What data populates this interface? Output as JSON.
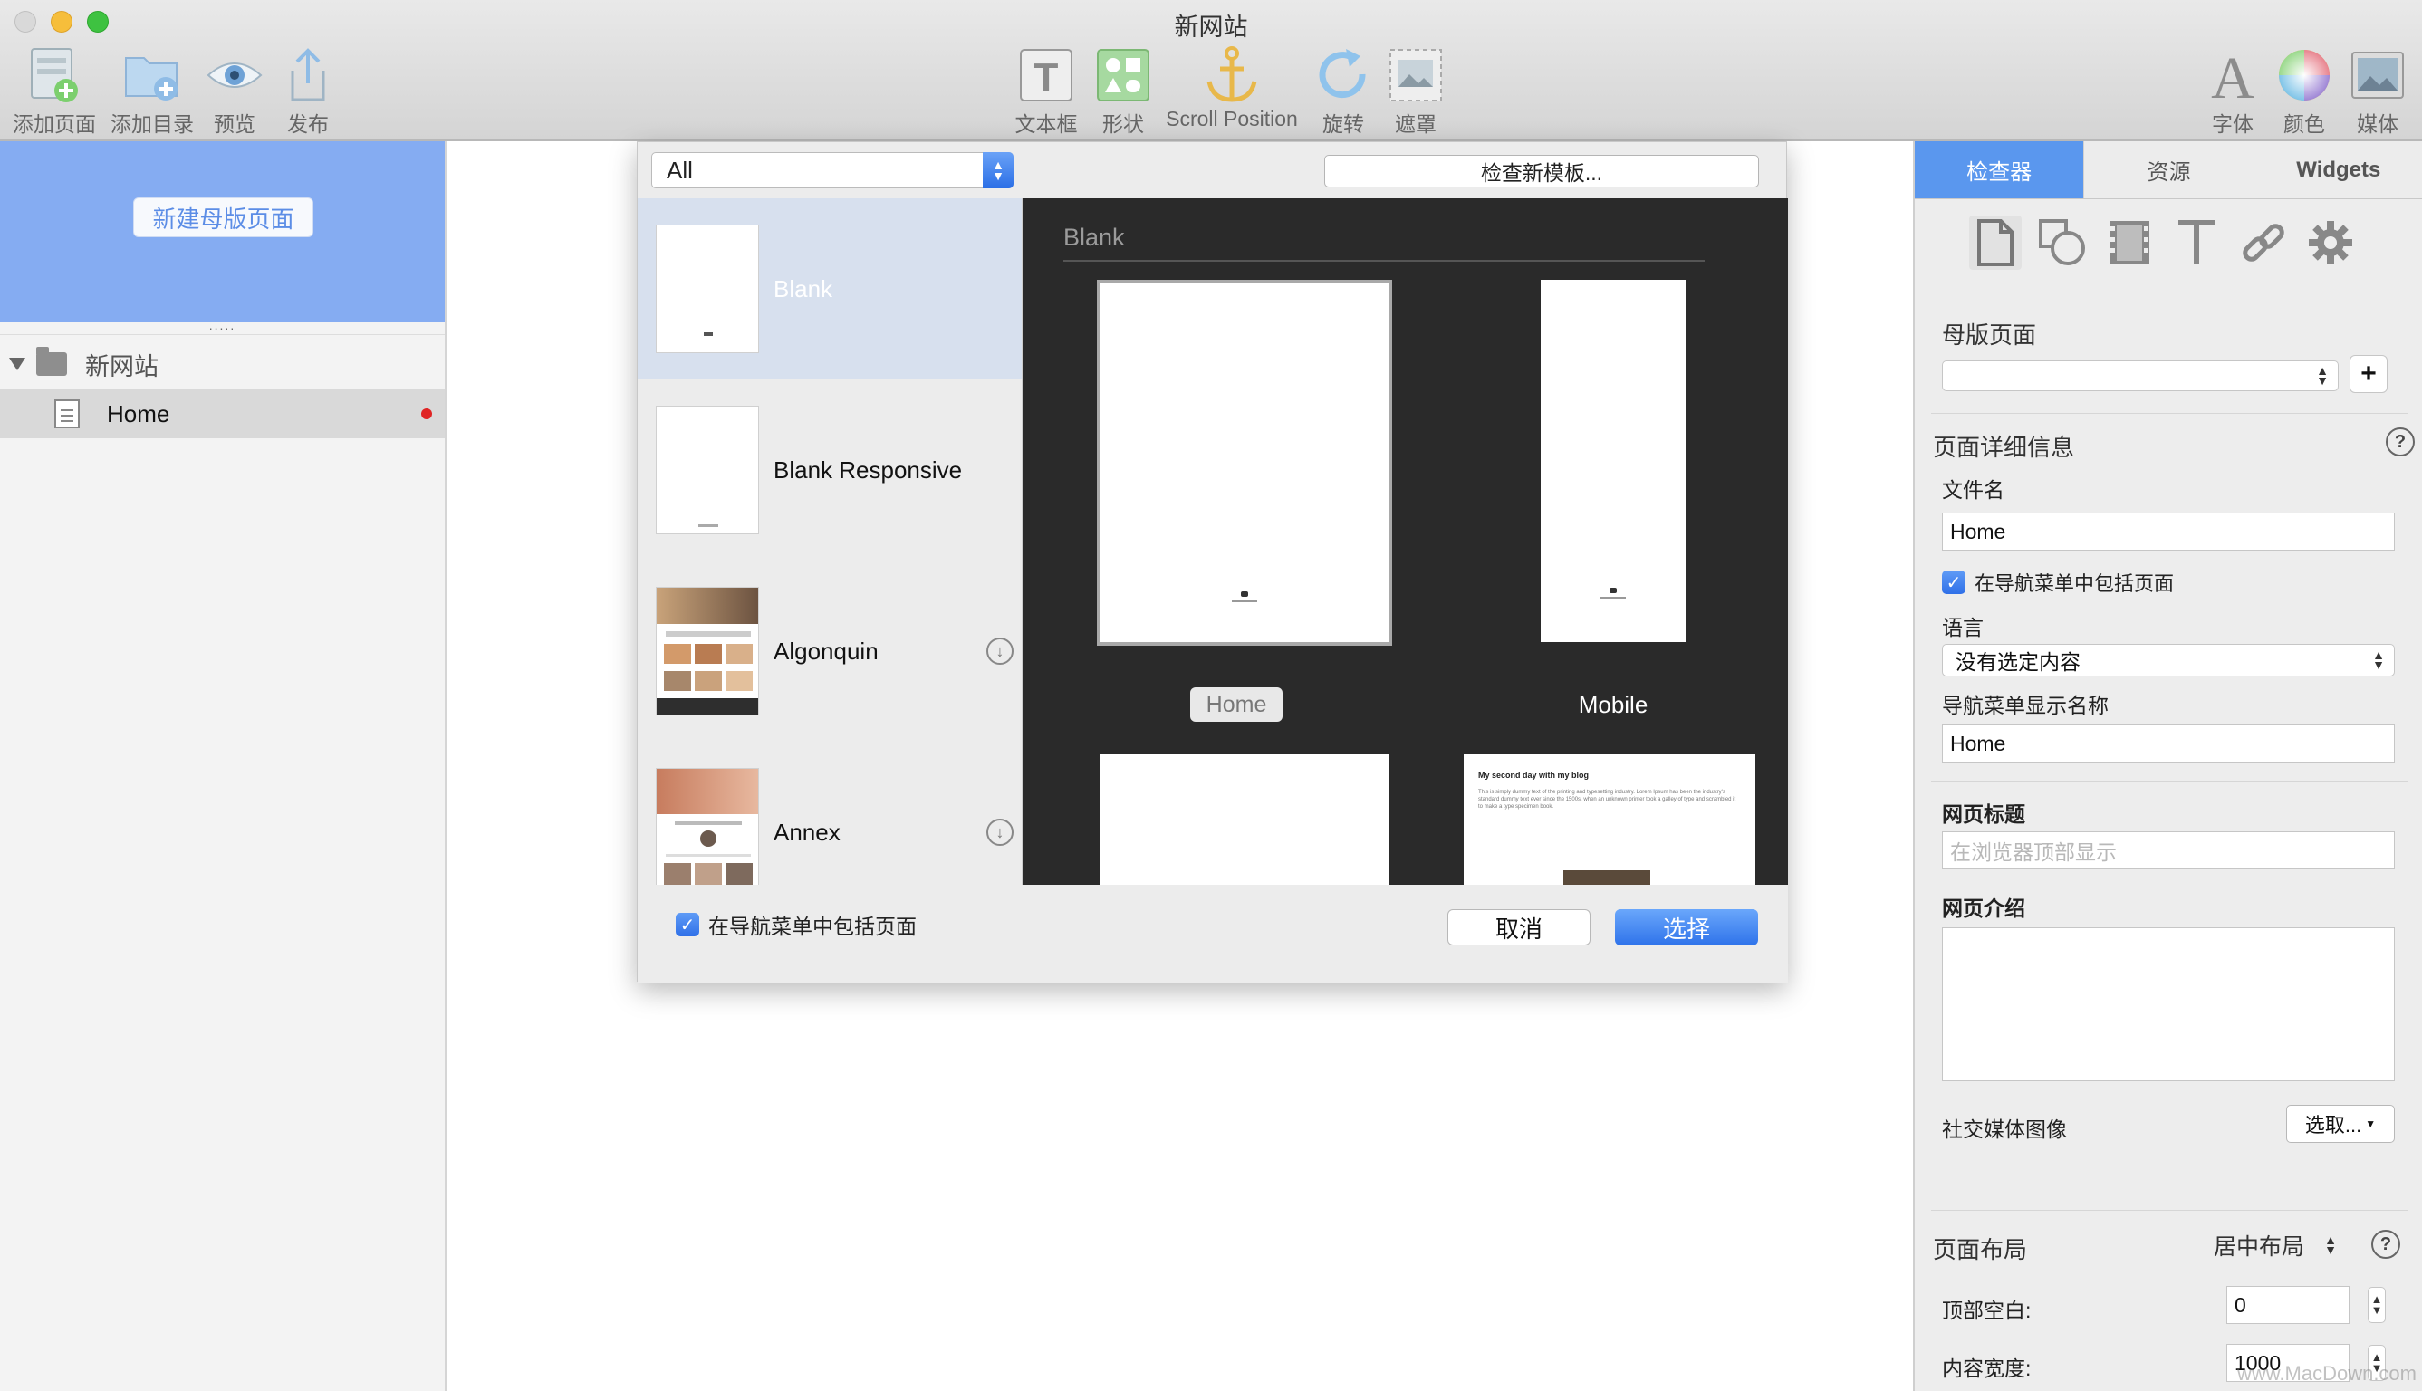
{
  "window": {
    "title": "新网站"
  },
  "toolbar": {
    "left": [
      {
        "label": "添加页面",
        "icon": "add-page-icon"
      },
      {
        "label": "添加目录",
        "icon": "add-folder-icon"
      },
      {
        "label": "预览",
        "icon": "eye-icon"
      },
      {
        "label": "发布",
        "icon": "publish-icon"
      }
    ],
    "center": [
      {
        "label": "文本框",
        "icon": "text-box-icon"
      },
      {
        "label": "形状",
        "icon": "shapes-icon"
      },
      {
        "label": "Scroll Position",
        "icon": "anchor-icon"
      },
      {
        "label": "旋转",
        "icon": "rotate-icon"
      },
      {
        "label": "遮罩",
        "icon": "mask-icon"
      }
    ],
    "right": [
      {
        "label": "字体",
        "icon": "font-icon"
      },
      {
        "label": "颜色",
        "icon": "color-wheel-icon"
      },
      {
        "label": "媒体",
        "icon": "media-icon"
      }
    ]
  },
  "sidebar": {
    "new_master_label": "新建母版页面",
    "splitter_dots": ".....",
    "site_name": "新网站",
    "pages": [
      {
        "label": "Home"
      }
    ]
  },
  "dialog": {
    "filter": {
      "value": "All"
    },
    "check_templates_label": "检查新模板...",
    "templates": [
      {
        "name": "Blank",
        "selected": true
      },
      {
        "name": "Blank Responsive"
      },
      {
        "name": "Algonquin",
        "downloadable": true
      },
      {
        "name": "Annex",
        "downloadable": true
      }
    ],
    "preview": {
      "heading": "Blank",
      "pages": [
        {
          "label": "Home"
        },
        {
          "label": "Mobile"
        }
      ],
      "blog_title": "My second day with my blog",
      "blog_body": "This is simply dummy text of the printing and typesetting industry. Lorem Ipsum has been the industry's standard dummy text ever since the 1500s, when an unknown printer took a galley of type and scrambled it to make a type specimen book."
    },
    "include_in_nav_label": "在导航菜单中包括页面",
    "cancel_label": "取消",
    "choose_label": "选择"
  },
  "inspector": {
    "tabs": [
      {
        "label": "检查器"
      },
      {
        "label": "资源"
      },
      {
        "label": "Widgets"
      }
    ],
    "icons": [
      "page-icon",
      "shape-icon",
      "film-icon",
      "text-icon",
      "link-icon",
      "gear-icon"
    ],
    "master_page": {
      "title": "母版页面",
      "value": ""
    },
    "page_details": {
      "title": "页面详细信息",
      "filename_label": "文件名",
      "filename_value": "Home",
      "include_in_nav_label": "在导航菜单中包括页面",
      "language_label": "语言",
      "language_value": "没有选定内容",
      "nav_name_label": "导航菜单显示名称",
      "nav_name_value": "Home"
    },
    "page_title": {
      "label": "网页标题",
      "placeholder": "在浏览器顶部显示"
    },
    "page_description": {
      "label": "网页介绍"
    },
    "social_image": {
      "label": "社交媒体图像",
      "button": "选取..."
    },
    "page_layout": {
      "title": "页面布局",
      "value": "居中布局",
      "top_margin_label": "顶部空白:",
      "top_margin_value": "0",
      "content_width_label": "内容宽度:",
      "content_width_value": "1000"
    },
    "help_glyph": "?"
  },
  "watermark": "www.MacDown.com",
  "colors": {
    "accent": "#2f73ea",
    "master_area": "#85acf2",
    "tab_active": "#5a97ee",
    "preview_bg": "#2a2a2a"
  }
}
